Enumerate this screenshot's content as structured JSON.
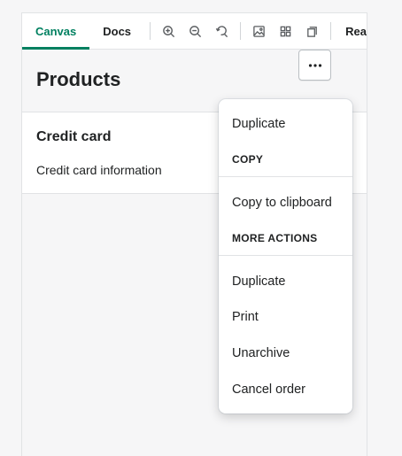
{
  "toolbar": {
    "tabs": [
      {
        "label": "Canvas",
        "active": true
      },
      {
        "label": "Docs",
        "active": false
      }
    ],
    "icons": [
      "zoom-in-icon",
      "zoom-out-icon",
      "zoom-reset-icon",
      "image-icon",
      "grid-icon",
      "frame-icon"
    ],
    "truncated_label": "Rea"
  },
  "page": {
    "title": "Products"
  },
  "card": {
    "title": "Credit card",
    "text": "Credit card information"
  },
  "menu": {
    "items_top": [
      "Duplicate"
    ],
    "section_copy": "COPY",
    "copy_items": [
      "Copy to clipboard"
    ],
    "section_more": "MORE ACTIONS",
    "more_items": [
      "Duplicate",
      "Print",
      "Unarchive",
      "Cancel order"
    ]
  },
  "colors": {
    "accent": "#008060",
    "text": "#202223",
    "border": "#e1e3e5"
  }
}
